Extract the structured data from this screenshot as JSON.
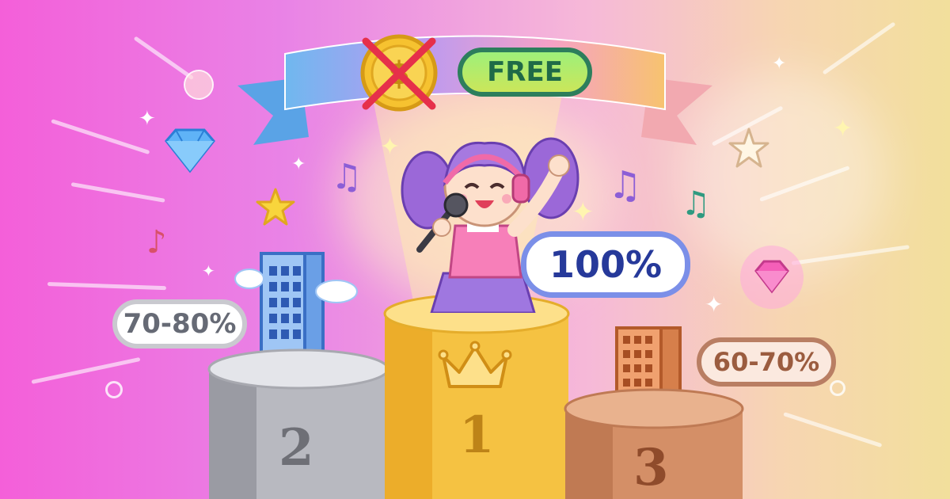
{
  "banner": {
    "free_label": "FREE",
    "icon": "crossed-out-coin-icon"
  },
  "rewards": {
    "first": "100%",
    "second": "70-80%",
    "third": "60-70%"
  },
  "podium": {
    "first_number": "1",
    "second_number": "2",
    "third_number": "3"
  },
  "colors": {
    "gold": "#f5c242",
    "silver": "#c5c6cc",
    "bronze": "#d48f67",
    "accent_blue": "#26399a",
    "free_green": "#2d7e5c"
  },
  "icons": [
    "diamond-icon",
    "star-icon",
    "music-note-icon",
    "crown-icon",
    "building-icon",
    "cloud-icon",
    "singer-girl-illustration",
    "pink-gem-icon"
  ]
}
